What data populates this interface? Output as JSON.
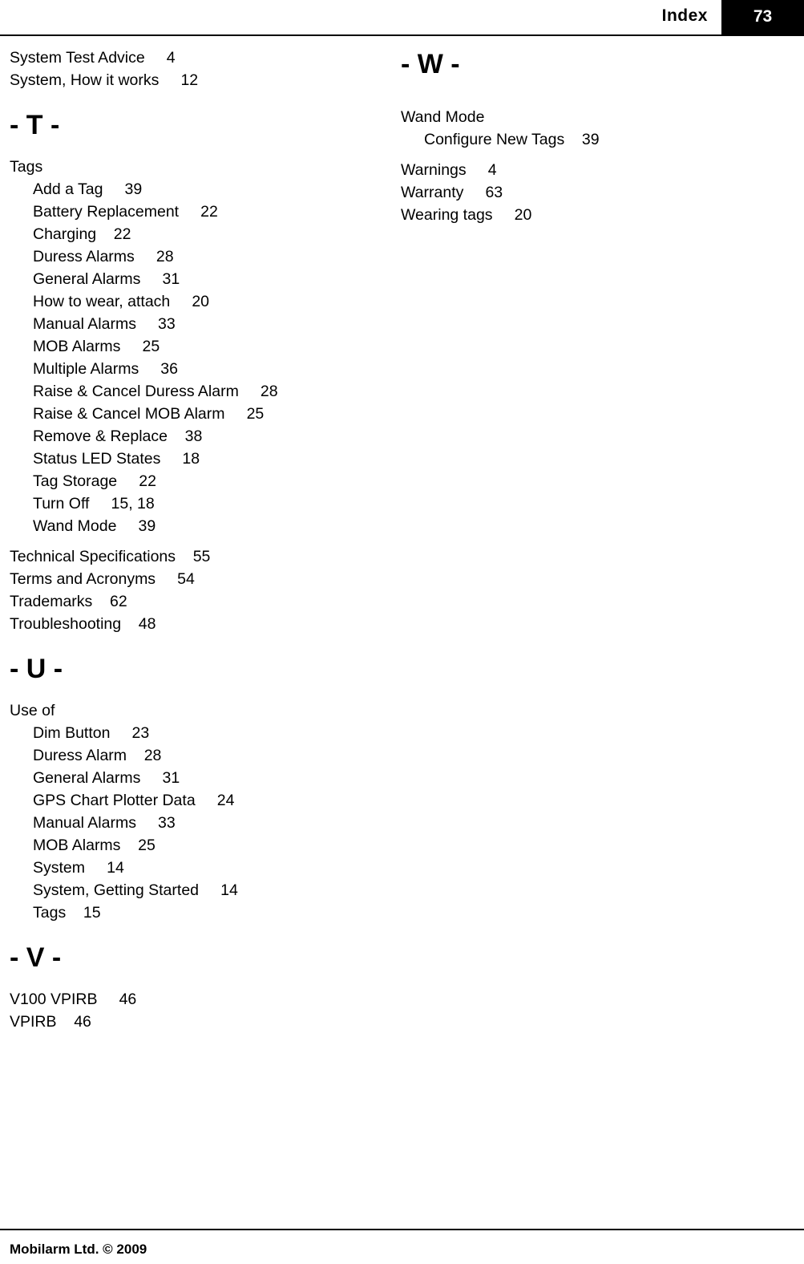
{
  "header": {
    "title": "Index",
    "page_number": "73"
  },
  "footer": {
    "text": "Mobilarm Ltd. © 2009"
  },
  "left_column": {
    "top_entries": [
      {
        "level": 1,
        "text": "System Test Advice     4"
      },
      {
        "level": 1,
        "text": "System, How it works     12"
      }
    ],
    "letter_t": "- T -",
    "t_entries": [
      {
        "level": 1,
        "text": "Tags"
      },
      {
        "level": 2,
        "text": "Add a Tag     39"
      },
      {
        "level": 2,
        "text": "Battery Replacement     22"
      },
      {
        "level": 2,
        "text": "Charging    22"
      },
      {
        "level": 2,
        "text": "Duress Alarms     28"
      },
      {
        "level": 2,
        "text": "General Alarms     31"
      },
      {
        "level": 2,
        "text": "How to wear, attach     20"
      },
      {
        "level": 2,
        "text": "Manual Alarms     33"
      },
      {
        "level": 2,
        "text": "MOB Alarms     25"
      },
      {
        "level": 2,
        "text": "Multiple Alarms     36"
      },
      {
        "level": 2,
        "text": "Raise & Cancel Duress Alarm     28"
      },
      {
        "level": 2,
        "text": "Raise & Cancel MOB Alarm     25"
      },
      {
        "level": 2,
        "text": "Remove & Replace    38"
      },
      {
        "level": 2,
        "text": "Status LED States     18"
      },
      {
        "level": 2,
        "text": "Tag Storage     22"
      },
      {
        "level": 2,
        "text": "Turn Off     15, 18"
      },
      {
        "level": 2,
        "text": "Wand Mode     39"
      }
    ],
    "t_entries_after": [
      {
        "level": 1,
        "text": "Technical Specifications    55"
      },
      {
        "level": 1,
        "text": "Terms and Acronyms     54"
      },
      {
        "level": 1,
        "text": "Trademarks    62"
      },
      {
        "level": 1,
        "text": "Troubleshooting    48"
      }
    ],
    "letter_u": "- U -",
    "u_entries": [
      {
        "level": 1,
        "text": "Use of"
      },
      {
        "level": 2,
        "text": "Dim Button     23"
      },
      {
        "level": 2,
        "text": "Duress Alarm    28"
      },
      {
        "level": 2,
        "text": "General Alarms     31"
      },
      {
        "level": 2,
        "text": "GPS Chart Plotter Data     24"
      },
      {
        "level": 2,
        "text": "Manual Alarms     33"
      },
      {
        "level": 2,
        "text": "MOB Alarms    25"
      },
      {
        "level": 2,
        "text": "System     14"
      },
      {
        "level": 2,
        "text": "System, Getting Started     14"
      },
      {
        "level": 2,
        "text": "Tags    15"
      }
    ],
    "letter_v": "- V -",
    "v_entries": [
      {
        "level": 1,
        "text": "V100 VPIRB     46"
      },
      {
        "level": 1,
        "text": "VPIRB    46"
      }
    ]
  },
  "right_column": {
    "letter_w": "- W -",
    "w_entries": [
      {
        "level": 1,
        "text": "Wand Mode"
      },
      {
        "level": 2,
        "text": "Configure New Tags    39"
      }
    ],
    "w_entries_after": [
      {
        "level": 1,
        "text": "Warnings     4"
      },
      {
        "level": 1,
        "text": "Warranty     63"
      },
      {
        "level": 1,
        "text": "Wearing tags     20"
      }
    ]
  }
}
